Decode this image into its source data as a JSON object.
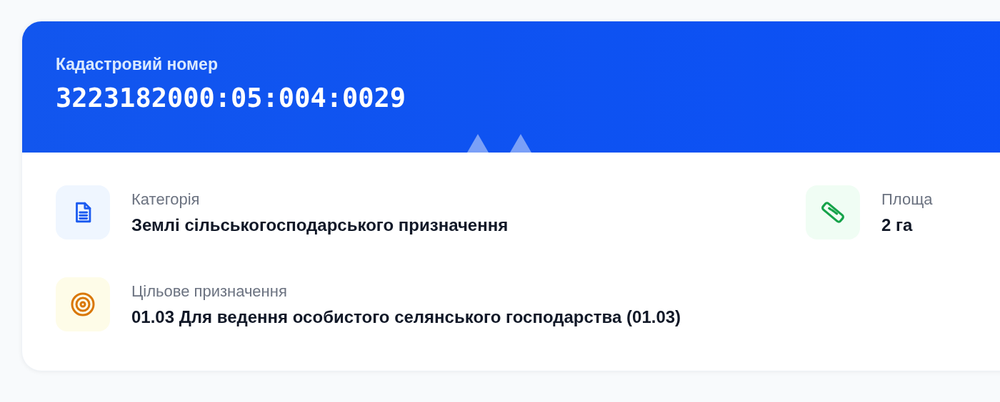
{
  "header": {
    "label": "Кадастровий номер",
    "number": "3223182000:05:004:0029"
  },
  "fields": [
    {
      "kind": "document",
      "label": "Категорія",
      "value": "Землі сільськогосподарського призначення"
    },
    {
      "kind": "ruler",
      "label": "Площа",
      "value": "2 га"
    },
    {
      "kind": "target",
      "label": "Цільове призначення",
      "value": "01.03 Для ведення особистого селянського господарства (01.03)"
    }
  ]
}
